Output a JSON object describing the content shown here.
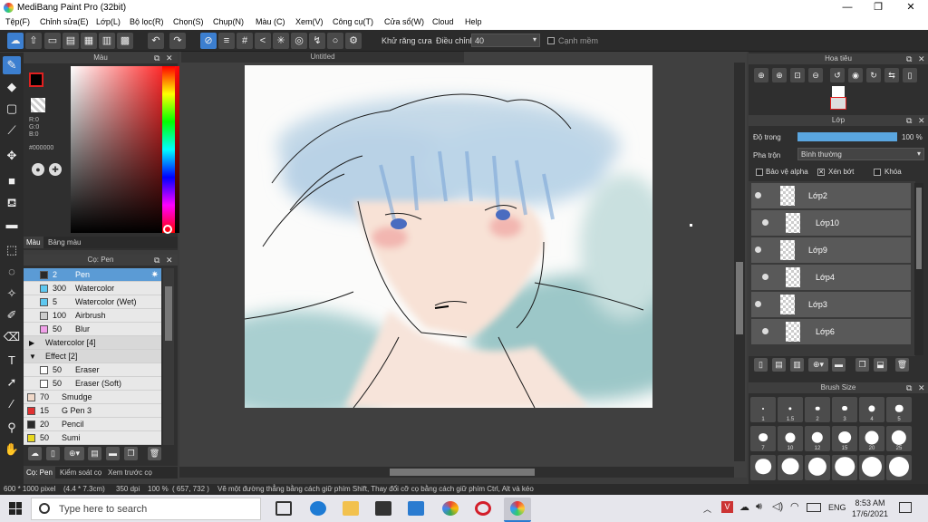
{
  "window": {
    "title": "MediBang Paint Pro (32bit)",
    "controls": {
      "minimize": "—",
      "maximize": "❐",
      "close": "✕"
    }
  },
  "menu": [
    "Tệp(F)",
    "Chỉnh sửa(E)",
    "Lớp(L)",
    "Bộ lọc(R)",
    "Chọn(S)",
    "Chụp(N)",
    "Màu (C)",
    "Xem(V)",
    "Công cụ(T)",
    "Cửa sổ(W)",
    "Cloud",
    "Help"
  ],
  "toolbar": {
    "antialias_label": "Khử răng cưa",
    "antialias_checked": true,
    "adjust_label": "Điều chỉnh",
    "adjust_value": "40",
    "edge_label": "Cạnh mềm",
    "edge_checked": false
  },
  "color_panel": {
    "title": "Màu",
    "rgb": {
      "r": "R:0",
      "g": "G:0",
      "b": "B:0"
    },
    "hex": "#000000",
    "primary_color": "#000000",
    "secondary_color": "#ffffff",
    "tabs": [
      "Màu",
      "Bảng màu"
    ]
  },
  "brush_panel": {
    "title": "Cọ: Pen",
    "rows": [
      {
        "size": "2",
        "name": "Pen",
        "color": "#2a2a2a",
        "selected": true,
        "indent": true
      },
      {
        "size": "300",
        "name": "Watercolor",
        "color": "#5ec8f0",
        "indent": true
      },
      {
        "size": "5",
        "name": "Watercolor (Wet)",
        "color": "#5ec8f0",
        "indent": true
      },
      {
        "size": "100",
        "name": "Airbrush",
        "color": "#cccccc",
        "indent": true
      },
      {
        "size": "50",
        "name": "Blur",
        "color": "#f0a0e8",
        "indent": true
      },
      {
        "group": true,
        "expanded": false,
        "name": "Watercolor [4]"
      },
      {
        "group": true,
        "expanded": true,
        "name": "Effect [2]"
      },
      {
        "size": "50",
        "name": "Eraser",
        "color": "#ffffff",
        "indent": true
      },
      {
        "size": "50",
        "name": "Eraser (Soft)",
        "color": "#ffffff",
        "indent": true
      },
      {
        "size": "70",
        "name": "Smudge",
        "color": "#f0d8c8",
        "indent": false
      },
      {
        "size": "15",
        "name": "G Pen 3",
        "color": "#e03030",
        "indent": false
      },
      {
        "size": "20",
        "name": "Pencil",
        "color": "#2a2a2a",
        "indent": false
      },
      {
        "size": "50",
        "name": "Sumi",
        "color": "#e8d820",
        "indent": false
      }
    ],
    "tabs": [
      "Cọ: Pen",
      "Kiểm soát cọ",
      "Xem trước cọ"
    ]
  },
  "document": {
    "tab_title": "Untitled"
  },
  "navigator": {
    "title": "Hoa tiêu"
  },
  "layers_panel": {
    "title": "Lớp",
    "opacity_label": "Độ trong",
    "opacity_value": "100 %",
    "opacity_level": 1.0,
    "blend_label": "Pha trộn",
    "blend_value": "Bình thường",
    "protect_alpha_label": "Bảo vệ alpha",
    "clipping_label": "Xén bớt",
    "lock_label": "Khóa",
    "protect_alpha_checked": false,
    "clipping_checked": true,
    "lock_checked": false,
    "layers": [
      "Lớp2",
      "Lớp10",
      "Lớp9",
      "Lớp4",
      "Lớp3",
      "Lớp6"
    ]
  },
  "brush_size_panel": {
    "title": "Brush Size",
    "sizes": [
      "1",
      "1.5",
      "2",
      "3",
      "4",
      "5",
      "7",
      "10",
      "12",
      "15",
      "20",
      "25"
    ]
  },
  "statusbar": {
    "canvas_size": "600 * 1000 pixel",
    "physical_size": "(4.4 * 7.3cm)",
    "dpi": "350 dpi",
    "zoom": "100 %",
    "cursor": "( 657, 732 )",
    "hint": "Vẽ một đường thẳng bằng cách giữ phím Shift, Thay đổi cỡ cọ bằng cách giữ phím Ctrl, Alt và kéo"
  },
  "taskbar": {
    "search_placeholder": "Type here to search",
    "language": "ENG",
    "time": "8:53 AM",
    "date": "17/6/2021"
  }
}
